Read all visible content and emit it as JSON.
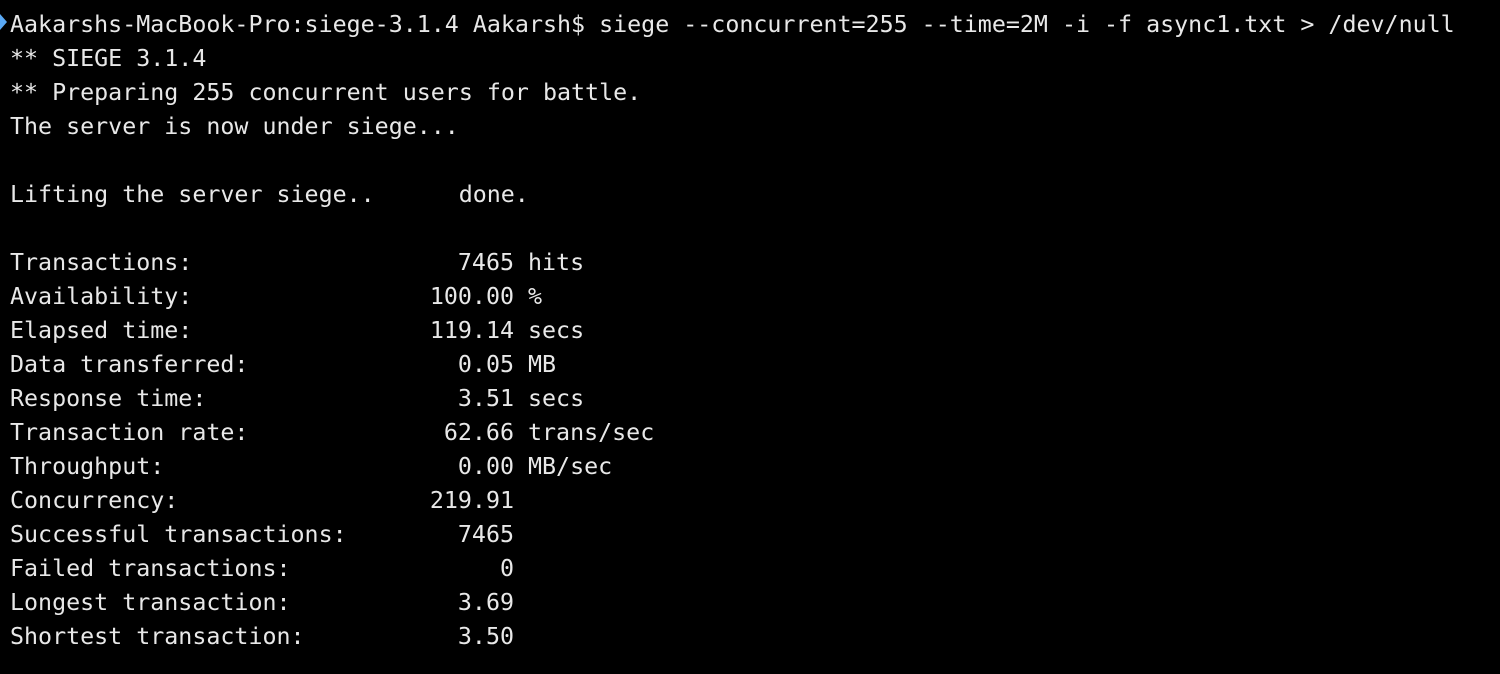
{
  "prompt": {
    "text": "Aakarshs-MacBook-Pro:siege-3.1.4 Aakarsh$ siege --concurrent=255 --time=2M -i -f async1.txt > /dev/null",
    "marker_icon": "prompt-marker-icon",
    "marker_color": "#5aa9f5"
  },
  "header": {
    "version": "** SIEGE 3.1.4",
    "preparing": "** Preparing 255 concurrent users for battle.",
    "under_siege": "The server is now under siege..."
  },
  "lifting": {
    "label": "Lifting the server siege..",
    "status": "done."
  },
  "stats": [
    {
      "label": "Transactions:",
      "value": "7465",
      "unit": "hits"
    },
    {
      "label": "Availability:",
      "value": "100.00",
      "unit": "%"
    },
    {
      "label": "Elapsed time:",
      "value": "119.14",
      "unit": "secs"
    },
    {
      "label": "Data transferred:",
      "value": "0.05",
      "unit": "MB"
    },
    {
      "label": "Response time:",
      "value": "3.51",
      "unit": "secs"
    },
    {
      "label": "Transaction rate:",
      "value": "62.66",
      "unit": "trans/sec"
    },
    {
      "label": "Throughput:",
      "value": "0.00",
      "unit": "MB/sec"
    },
    {
      "label": "Concurrency:",
      "value": "219.91",
      "unit": ""
    },
    {
      "label": "Successful transactions:",
      "value": "7465",
      "unit": ""
    },
    {
      "label": "Failed transactions:",
      "value": "0",
      "unit": ""
    },
    {
      "label": "Longest transaction:",
      "value": "3.69",
      "unit": ""
    },
    {
      "label": "Shortest transaction:",
      "value": "3.50",
      "unit": ""
    }
  ],
  "colors": {
    "background": "#000000",
    "foreground": "#e8e8e8"
  }
}
